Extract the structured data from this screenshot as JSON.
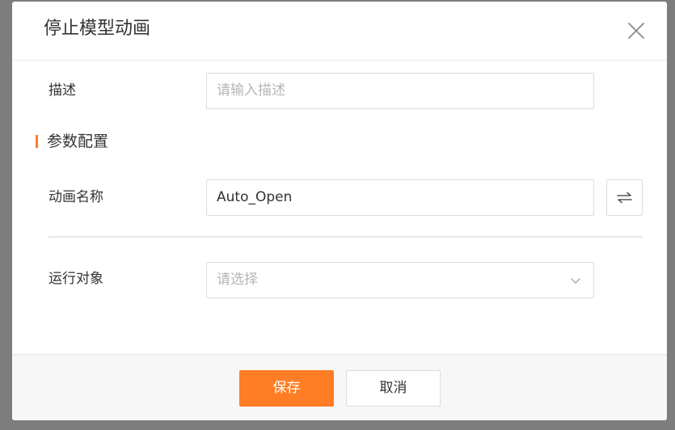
{
  "dialog": {
    "title": "停止模型动画",
    "close_icon": "close-icon"
  },
  "description": {
    "label": "描述",
    "placeholder": "请输入描述",
    "value": ""
  },
  "section": {
    "title": "参数配置",
    "accent_color": "#ff7d27"
  },
  "animation_name": {
    "label": "动画名称",
    "value": "Auto_Open",
    "swap_icon": "swap-arrows-icon"
  },
  "run_target": {
    "label": "运行对象",
    "placeholder": "请选择",
    "value": "",
    "chevron_icon": "chevron-down-icon"
  },
  "footer": {
    "save_label": "保存",
    "cancel_label": "取消",
    "save_color": "#ff7d24"
  }
}
